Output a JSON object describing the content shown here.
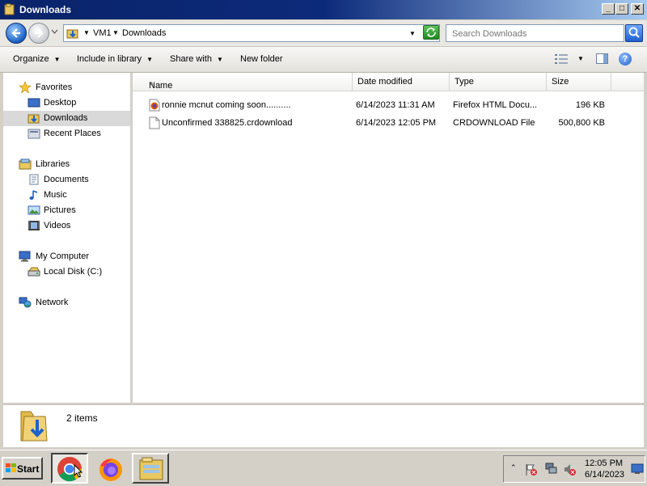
{
  "window": {
    "title": "Downloads",
    "controls": {
      "minimize": "_",
      "maximize": "□",
      "close": "✕"
    }
  },
  "address": {
    "crumbs": [
      "VM1",
      "Downloads"
    ],
    "search_placeholder": "Search Downloads"
  },
  "commands": {
    "organize": "Organize",
    "include_in_library": "Include in library",
    "share_with": "Share with",
    "new_folder": "New folder",
    "help": "?"
  },
  "nav": {
    "favorites": {
      "label": "Favorites",
      "items": [
        {
          "label": "Desktop",
          "icon": "desktop-icon"
        },
        {
          "label": "Downloads",
          "icon": "downloads-folder-icon",
          "selected": true
        },
        {
          "label": "Recent Places",
          "icon": "recent-places-icon"
        }
      ]
    },
    "libraries": {
      "label": "Libraries",
      "items": [
        {
          "label": "Documents",
          "icon": "documents-icon"
        },
        {
          "label": "Music",
          "icon": "music-icon"
        },
        {
          "label": "Pictures",
          "icon": "pictures-icon"
        },
        {
          "label": "Videos",
          "icon": "videos-icon"
        }
      ]
    },
    "computer": {
      "label": "My Computer",
      "items": [
        {
          "label": "Local Disk (C:)",
          "icon": "local-disk-icon"
        }
      ]
    },
    "network": {
      "label": "Network"
    }
  },
  "files": {
    "columns": [
      "Name",
      "Date modified",
      "Type",
      "Size"
    ],
    "rows": [
      {
        "name": "ronnie mcnut coming soon..........",
        "date": "6/14/2023 11:31 AM",
        "type": "Firefox HTML Docu...",
        "size": "196 KB",
        "icon": "firefox-html-file-icon"
      },
      {
        "name": "Unconfirmed 338825.crdownload",
        "date": "6/14/2023 12:05 PM",
        "type": "CRDOWNLOAD File",
        "size": "500,800 KB",
        "icon": "blank-file-icon"
      }
    ]
  },
  "details": {
    "count": "2 items"
  },
  "taskbar": {
    "start": "Start",
    "apps": [
      "chrome-icon",
      "firefox-icon",
      "explorer-icon"
    ],
    "clock_time": "12:05 PM",
    "clock_date": "6/14/2023"
  }
}
